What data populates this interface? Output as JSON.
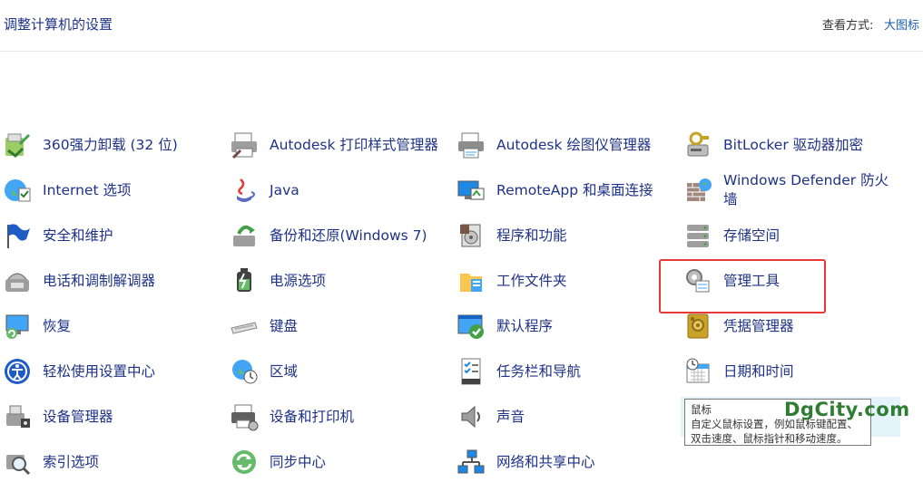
{
  "header": {
    "title": "调整计算机的设置",
    "view_by_label": "查看方式:",
    "view_by_value": "大图标"
  },
  "items": [
    {
      "label": "360强力卸载 (32 位)",
      "icon": "uninstall-icon"
    },
    {
      "label": "Autodesk 打印样式管理器",
      "icon": "printer-style-icon"
    },
    {
      "label": "Autodesk 绘图仪管理器",
      "icon": "plotter-icon"
    },
    {
      "label": "BitLocker 驱动器加密",
      "icon": "bitlocker-icon"
    },
    {
      "label": "Internet 选项",
      "icon": "internet-options-icon"
    },
    {
      "label": "Java",
      "icon": "java-icon"
    },
    {
      "label": "RemoteApp 和桌面连接",
      "icon": "remoteapp-icon"
    },
    {
      "label": "Windows Defender 防火墙",
      "icon": "firewall-icon"
    },
    {
      "label": "安全和维护",
      "icon": "flag-icon"
    },
    {
      "label": "备份和还原(Windows 7)",
      "icon": "backup-icon"
    },
    {
      "label": "程序和功能",
      "icon": "programs-icon"
    },
    {
      "label": "存储空间",
      "icon": "storage-icon"
    },
    {
      "label": "电话和调制解调器",
      "icon": "phone-modem-icon"
    },
    {
      "label": "电源选项",
      "icon": "power-icon"
    },
    {
      "label": "工作文件夹",
      "icon": "work-folders-icon"
    },
    {
      "label": "管理工具",
      "icon": "admin-tools-icon"
    },
    {
      "label": "恢复",
      "icon": "recovery-icon"
    },
    {
      "label": "键盘",
      "icon": "keyboard-icon"
    },
    {
      "label": "默认程序",
      "icon": "default-programs-icon"
    },
    {
      "label": "凭据管理器",
      "icon": "credential-manager-icon"
    },
    {
      "label": "轻松使用设置中心",
      "icon": "ease-of-access-icon"
    },
    {
      "label": "区域",
      "icon": "region-icon"
    },
    {
      "label": "任务栏和导航",
      "icon": "taskbar-icon"
    },
    {
      "label": "日期和时间",
      "icon": "date-time-icon"
    },
    {
      "label": "设备管理器",
      "icon": "device-manager-icon"
    },
    {
      "label": "设备和打印机",
      "icon": "devices-printers-icon"
    },
    {
      "label": "声音",
      "icon": "sound-icon"
    },
    {
      "label": "鼠标",
      "icon": "mouse-icon"
    },
    {
      "label": "索引选项",
      "icon": "indexing-icon"
    },
    {
      "label": "同步中心",
      "icon": "sync-center-icon"
    },
    {
      "label": "网络和共享中心",
      "icon": "network-icon"
    }
  ],
  "tooltip": {
    "title": "鼠标",
    "line1": "自定义鼠标设置，例如鼠标键配置、",
    "line2": "双击速度、鼠标指针和移动速度。"
  },
  "watermark": "DgCity.com",
  "colors": {
    "link": "#1e3287",
    "hover_bg": "#e5f3fb",
    "highlight_box": "#e53935",
    "watermark": "#2e7d32"
  }
}
